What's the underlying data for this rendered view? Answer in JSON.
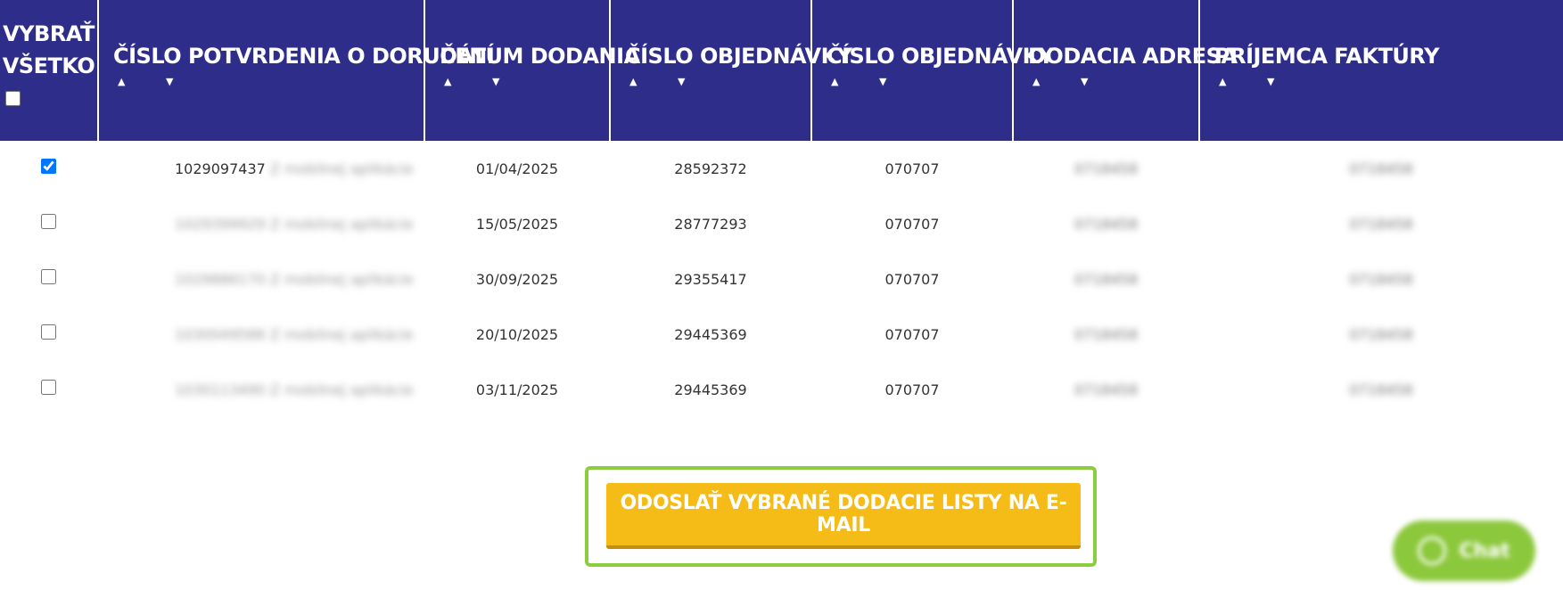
{
  "headers": {
    "select_all": "VYBRAŤ VŠETKO",
    "columns": [
      "ČÍSLO POTVRDENIA O DORUČENÍ",
      "DÁTUM DODANIA",
      "ČÍSLO OBJEDNÁVKY",
      "ČÍSLO OBJEDNÁVKY",
      "DODACIA ADRESA",
      "PRÍJEMCA FAKTÚRY"
    ],
    "sort_asc_icon": "▲",
    "sort_desc_icon": "▼"
  },
  "rows": [
    {
      "checked": true,
      "doc": "1029097437",
      "doc_suffix": "Z mobilnej aplikácie",
      "date": "01/04/2025",
      "order1": "28592372",
      "order2": "070707",
      "address": "0718458",
      "recipient": "0718458"
    },
    {
      "checked": false,
      "doc": "1029399929",
      "doc_suffix": "Z mobilnej aplikácie",
      "date": "15/05/2025",
      "order1": "28777293",
      "order2": "070707",
      "address": "0718458",
      "recipient": "0718458"
    },
    {
      "checked": false,
      "doc": "1029886170",
      "doc_suffix": "Z mobilnej aplikácie",
      "date": "30/09/2025",
      "order1": "29355417",
      "order2": "070707",
      "address": "0718458",
      "recipient": "0718458"
    },
    {
      "checked": false,
      "doc": "1030049586",
      "doc_suffix": "Z mobilnej aplikácie",
      "date": "20/10/2025",
      "order1": "29445369",
      "order2": "070707",
      "address": "0718458",
      "recipient": "0718458"
    },
    {
      "checked": false,
      "doc": "1030113490",
      "doc_suffix": "Z mobilnej aplikácie",
      "date": "03/11/2025",
      "order1": "29445369",
      "order2": "070707",
      "address": "0718458",
      "recipient": "0718458"
    }
  ],
  "send_button_label": "ODOSLAŤ VYBRANÉ DODACIE LISTY NA E-MAIL",
  "chat_label": "Chat",
  "colors": {
    "header_bg": "#2e2e8a",
    "button_bg": "#f5bb17",
    "button_frame": "#8ccc3f",
    "chat_bg": "#8cc83c"
  }
}
